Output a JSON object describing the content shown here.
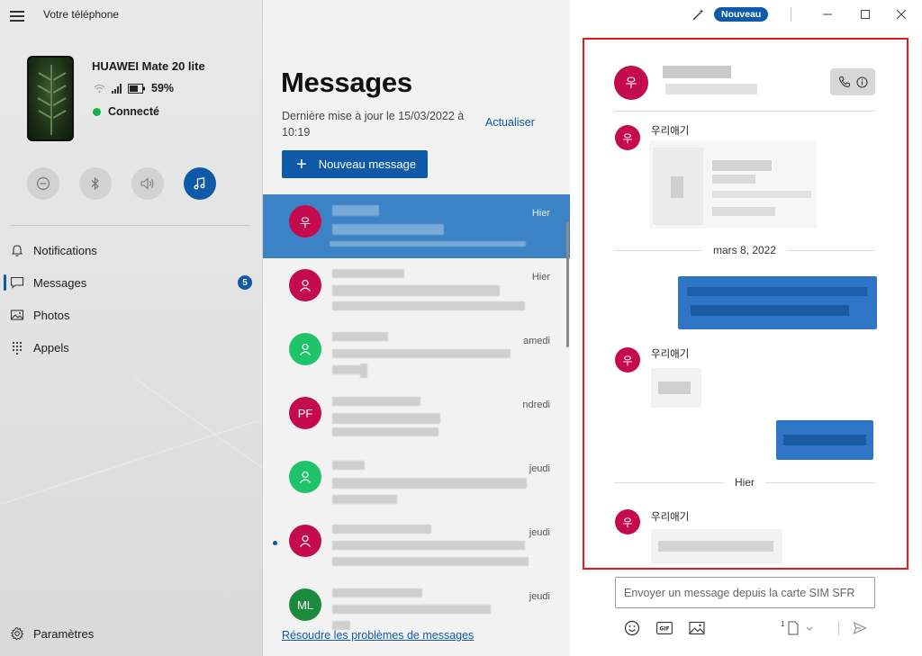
{
  "app": {
    "title": "Votre téléphone",
    "new_badge": "Nouveau"
  },
  "device": {
    "name": "HUAWEI Mate 20 lite",
    "battery": "59%",
    "status": "Connecté"
  },
  "nav": {
    "items": [
      {
        "label": "Notifications",
        "icon": "bell-icon"
      },
      {
        "label": "Messages",
        "icon": "message-icon",
        "badge": "5"
      },
      {
        "label": "Photos",
        "icon": "photo-icon"
      },
      {
        "label": "Appels",
        "icon": "dialpad-icon"
      }
    ],
    "settings": "Paramètres"
  },
  "messages": {
    "title": "Messages",
    "updated": "Dernière mise à jour le 15/03/2022 à 10:19",
    "refresh": "Actualiser",
    "new_message": "Nouveau message",
    "troubleshoot": "Résoudre les problèmes de messages",
    "conversations": [
      {
        "initials": "우",
        "color": "#c40b4d",
        "date": "Hier",
        "selected": true
      },
      {
        "initials": "",
        "color": "#c40b4d",
        "date": "Hier"
      },
      {
        "initials": "",
        "color": "#1fc36a",
        "date": "amedi"
      },
      {
        "initials": "PF",
        "color": "#c40b4d",
        "date": "ndredi"
      },
      {
        "initials": "",
        "color": "#1fc36a",
        "date": "jeudi"
      },
      {
        "initials": "",
        "color": "#c40b4d",
        "date": "jeudi",
        "unread": true
      },
      {
        "initials": "ML",
        "color": "#1b8a3c",
        "date": "jeudi"
      }
    ]
  },
  "chat": {
    "avatar": "우",
    "sender": "우리애기",
    "date_1": "mars 8, 2022",
    "date_2": "Hier",
    "compose_placeholder": "Envoyer un message depuis la carte SIM SFR",
    "sim_label": "1"
  },
  "colors": {
    "accent": "#0f5aa8",
    "highlight_frame": "#e01b1b",
    "online": "#16b14a"
  }
}
